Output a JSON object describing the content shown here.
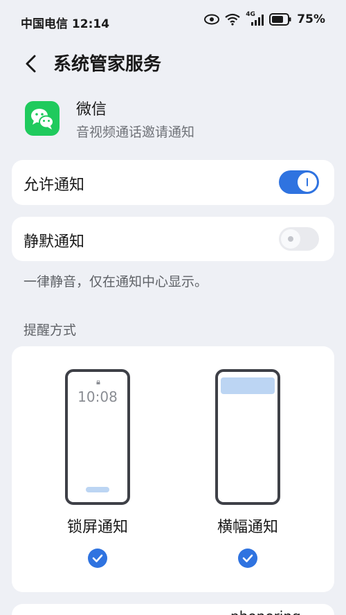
{
  "status_bar": {
    "carrier_time": "中国电信 12:14",
    "network": "4G",
    "battery": "75%"
  },
  "header": {
    "title": "系统管家服务"
  },
  "app": {
    "name": "微信",
    "subtitle": "音视频通话邀请通知"
  },
  "settings": {
    "allow_notifications": {
      "label": "允许通知",
      "enabled": true
    },
    "silent_notifications": {
      "label": "静默通知",
      "enabled": false
    },
    "silent_hint": "一律静音，仅在通知中心显示。"
  },
  "reminder": {
    "section_title": "提醒方式",
    "options": [
      {
        "label": "锁屏通知",
        "preview_time": "10:08",
        "checked": true
      },
      {
        "label": "横幅通知",
        "checked": true
      }
    ]
  },
  "bottom_partial_text": "phonering",
  "colors": {
    "accent": "#2f73e0",
    "wechat_green": "#1fca5d",
    "background": "#eef0f5"
  }
}
